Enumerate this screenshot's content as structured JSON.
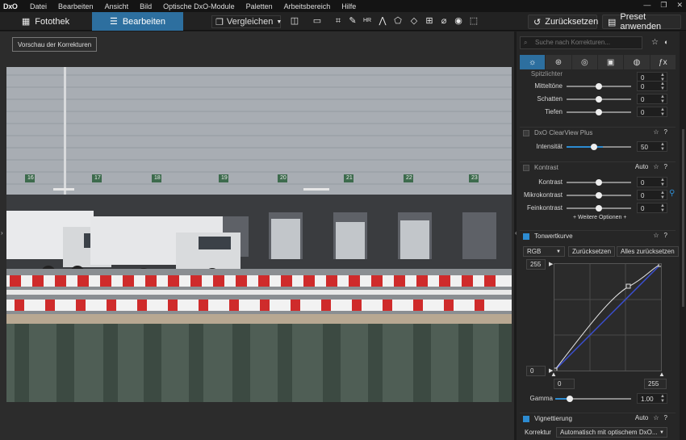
{
  "menubar": {
    "logo": "DxO",
    "items": [
      "Datei",
      "Bearbeiten",
      "Ansicht",
      "Bild",
      "Optische DxO-Module",
      "Paletten",
      "Arbeitsbereich",
      "Hilfe"
    ]
  },
  "toolbar": {
    "tab_fotothek": "Fotothek",
    "tab_bearbeiten": "Bearbeiten",
    "compare": "Vergleichen",
    "reset": "Zurücksetzen",
    "preset": "Preset anwenden"
  },
  "viewer": {
    "preview_button": "Vorschau der Korrekturen",
    "dock_numbers": [
      "16",
      "17",
      "18",
      "19",
      "20",
      "21",
      "22",
      "23"
    ]
  },
  "panel": {
    "search_placeholder": "Suche nach Korrekturen...",
    "tabs": [
      "light",
      "color",
      "detail",
      "geometry",
      "local",
      "fx"
    ],
    "tone_rows": [
      {
        "label": "Spitzlichter",
        "value": "0",
        "pos": 0.5
      },
      {
        "label": "Mitteltöne",
        "value": "0",
        "pos": 0.5
      },
      {
        "label": "Schatten",
        "value": "0",
        "pos": 0.5
      },
      {
        "label": "Tiefen",
        "value": "0",
        "pos": 0.5
      }
    ],
    "clearview": {
      "title": "DxO ClearView Plus",
      "row": {
        "label": "Intensität",
        "value": "50",
        "pos": 0.5
      }
    },
    "kontrast": {
      "title": "Kontrast",
      "auto": "Auto",
      "rows": [
        {
          "label": "Kontrast",
          "value": "0",
          "pos": 0.5
        },
        {
          "label": "Mikrokontrast",
          "value": "0",
          "pos": 0.5
        },
        {
          "label": "Feinkontrast",
          "value": "0",
          "pos": 0.5
        }
      ],
      "more": "+ Weitere Optionen +"
    },
    "tonwert": {
      "title": "Tonwertkurve",
      "channel": "RGB",
      "reset": "Zurücksetzen",
      "reset_all": "Alles zurücksetzen",
      "top_value": "255",
      "in_low": "0",
      "in_high": "255",
      "out_low": "0",
      "gamma_label": "Gamma",
      "gamma_value": "1.00",
      "gamma_pos": 0.1
    },
    "vignette": {
      "title": "Vignettierung",
      "auto": "Auto",
      "correction_label": "Korrektur",
      "correction_value": "Automatisch mit optischem DxO..."
    }
  }
}
